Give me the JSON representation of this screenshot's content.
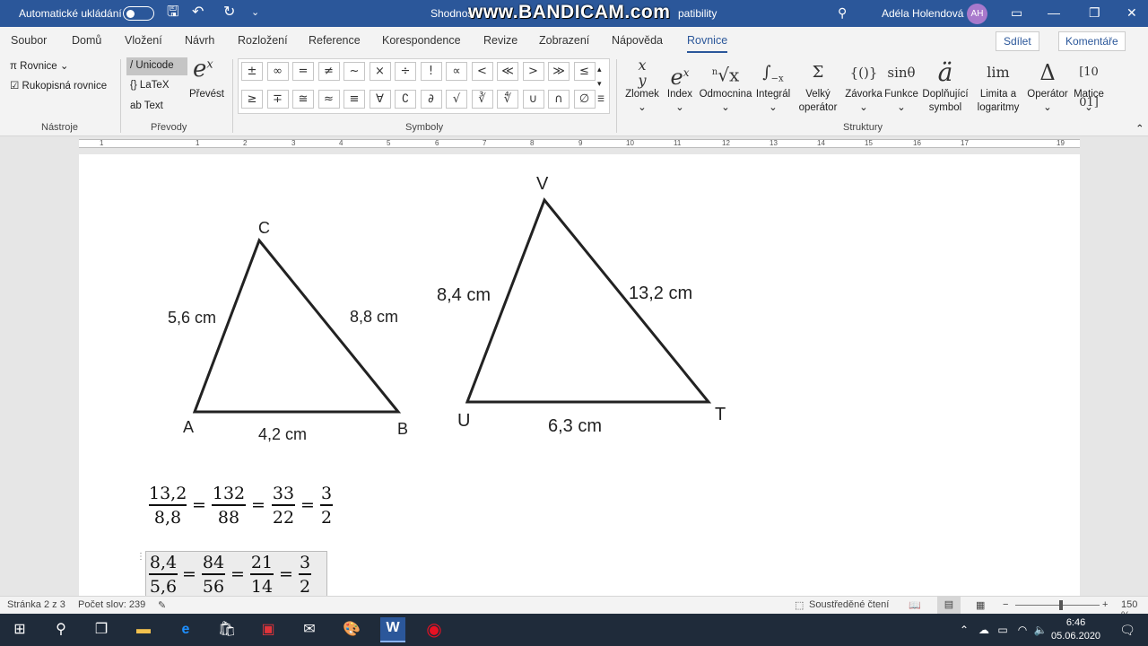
{
  "titlebar": {
    "autosave": "Automatické ukládání",
    "doc_name": "Shodnos",
    "watermark": "www.BANDICAM.com",
    "compat": "patibility",
    "user": "Adéla Holendová",
    "initials": "AH"
  },
  "tabs": [
    "Soubor",
    "Domů",
    "Vložení",
    "Návrh",
    "Rozložení",
    "Reference",
    "Korespondence",
    "Revize",
    "Zobrazení",
    "Nápověda",
    "Rovnice"
  ],
  "share": "Sdílet",
  "comments": "Komentáře",
  "ribbon": {
    "tools": {
      "equation": "Rovnice",
      "ink": "Rukopisná rovnice",
      "label": "Nástroje"
    },
    "conversions": {
      "unicode": "Unicode",
      "latex": "LaTeX",
      "text": "Text",
      "convert": "Převést",
      "label": "Převody"
    },
    "symbols": {
      "row1": [
        "±",
        "∞",
        "=",
        "≠",
        "~",
        "×",
        "÷",
        "!",
        "∝",
        "<",
        "≪",
        ">",
        "≫",
        "≤"
      ],
      "row2": [
        "≥",
        "∓",
        "≅",
        "≈",
        "≡",
        "∀",
        "∁",
        "∂",
        "√",
        "∛",
        "∜",
        "∪",
        "∩",
        "∅"
      ],
      "label": "Symboly"
    },
    "structures": {
      "items": [
        "Zlomek",
        "Index",
        "Odmocnina",
        "Integrál",
        "Velký operátor",
        "Závorka",
        "Funkce",
        "Doplňující symbol",
        "Limita a logaritmy",
        "Operátor",
        "Matice"
      ],
      "label": "Struktury"
    }
  },
  "ruler": [
    "1",
    "1",
    "2",
    "3",
    "4",
    "5",
    "6",
    "7",
    "8",
    "9",
    "10",
    "11",
    "12",
    "13",
    "14",
    "15",
    "16",
    "17",
    "19"
  ],
  "triangle1": {
    "A": "A",
    "B": "B",
    "C": "C",
    "ac": "5,6 cm",
    "bc": "8,8 cm",
    "ab": "4,2 cm"
  },
  "triangle2": {
    "U": "U",
    "T": "T",
    "V": "V",
    "uv": "8,4 cm",
    "vt": "13,2 cm",
    "ut": "6,3 cm"
  },
  "eq1": [
    [
      "13,2",
      "8,8"
    ],
    [
      "132",
      "88"
    ],
    [
      "33",
      "22"
    ],
    [
      "3",
      "2"
    ]
  ],
  "eq2": [
    [
      "8,4",
      "5,6"
    ],
    [
      "84",
      "56"
    ],
    [
      "21",
      "14"
    ],
    [
      "3",
      "2"
    ]
  ],
  "status": {
    "page": "Stránka 2 z 3",
    "words": "Počet slov: 239",
    "focus": "Soustředěné čtení",
    "zoom": "150 %"
  },
  "clock": {
    "time": "6:46",
    "date": "05.06.2020"
  }
}
